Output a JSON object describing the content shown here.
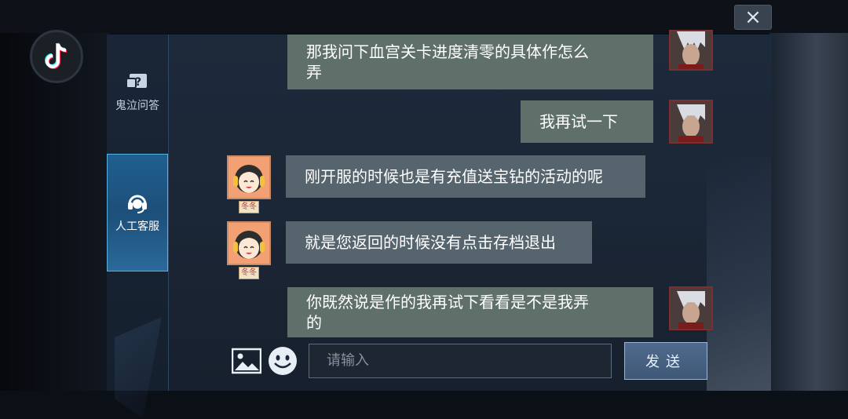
{
  "close": {
    "label": "×"
  },
  "sidebar": {
    "items": [
      {
        "label": "鬼泣问答",
        "icon": "question-icon",
        "active": false
      },
      {
        "label": "人工客服",
        "icon": "headset-icon",
        "active": true
      }
    ]
  },
  "messages": [
    {
      "from": "user",
      "text_line1": "那我问下血宫关卡进度清零的具体作怎么",
      "text_line2": "弄"
    },
    {
      "from": "user",
      "text": "我再试一下"
    },
    {
      "from": "agent",
      "text": "刚开服的时候也是有充值送宝钻的活动的呢",
      "name": "冬冬"
    },
    {
      "from": "agent",
      "text": "就是您返回的时候没有点击存档退出",
      "name": "冬冬"
    },
    {
      "from": "user",
      "text_line1": "你既然说是作的我再试下看看是不是我弄",
      "text_line2": "的"
    }
  ],
  "composer": {
    "placeholder": "请输入",
    "send_label": "发送",
    "image_icon": "image-icon",
    "emoji_icon": "emoji-icon"
  },
  "colors": {
    "bubble_user": "#5f6f6a",
    "bubble_agent": "#56646e",
    "sidebar_active": "#1f5f8f"
  }
}
